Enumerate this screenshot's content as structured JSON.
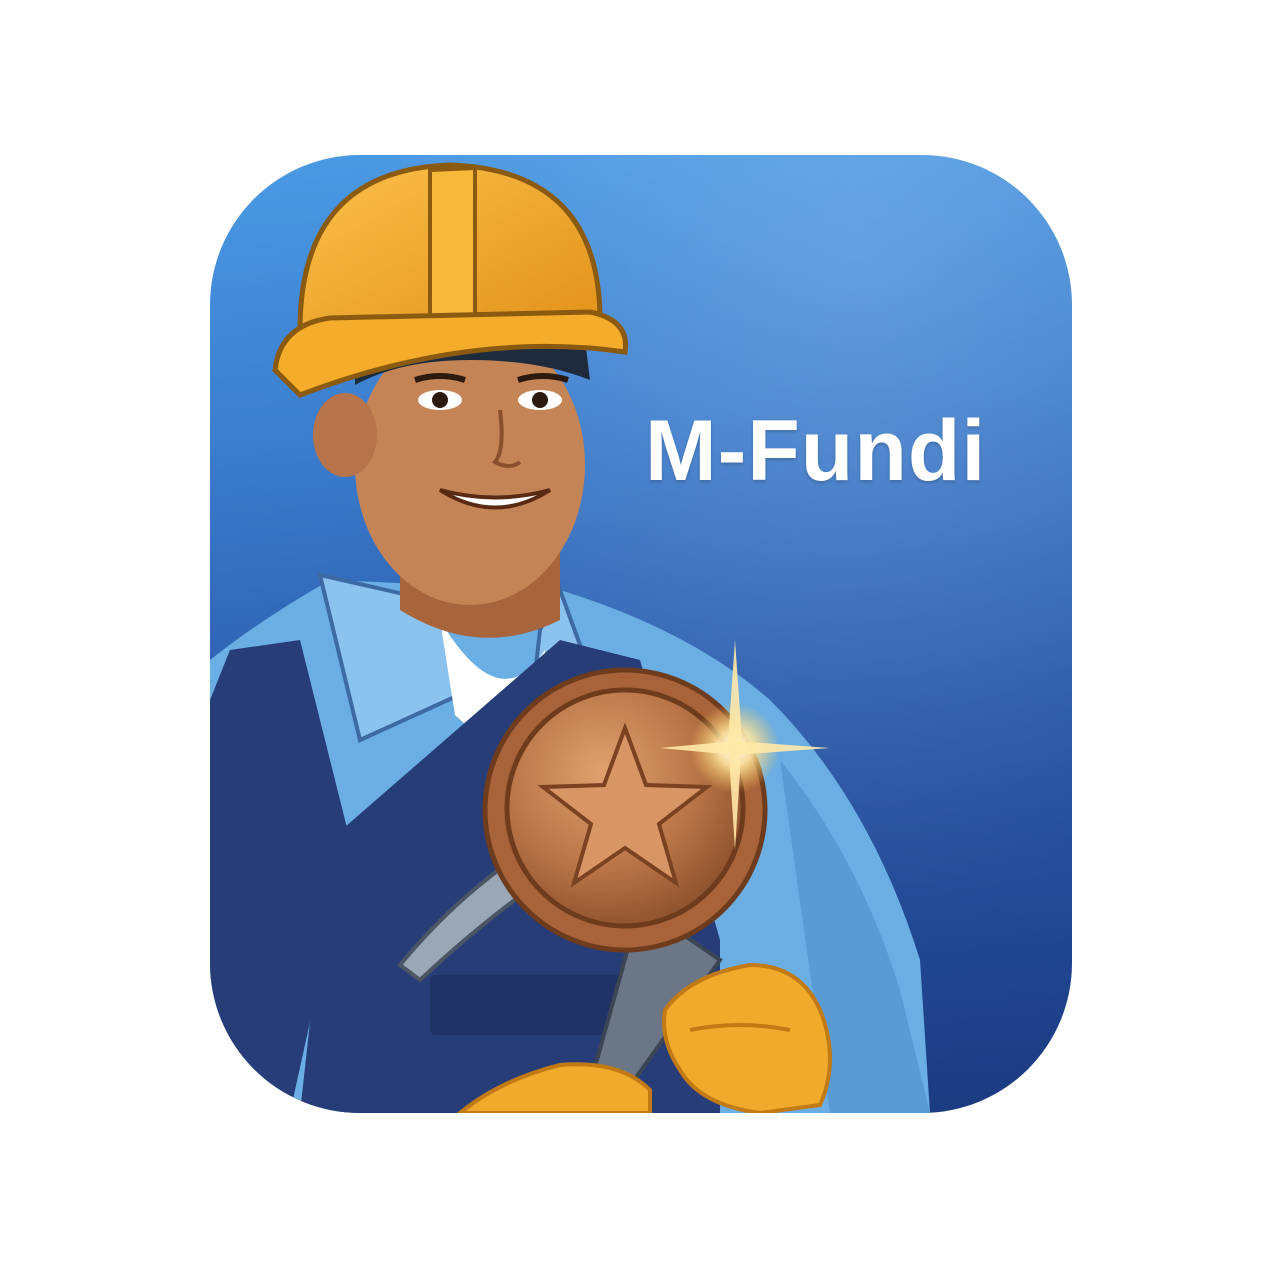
{
  "app_icon": {
    "brand_name": "M-Fundi"
  },
  "illustration": {
    "subject": "worker-with-medal",
    "icons": [
      "hard-hat-icon",
      "medal-icon",
      "star-icon",
      "pickaxe-icon",
      "sparkle-icon",
      "gloves-icon"
    ]
  },
  "colors": {
    "background_top": "#4a9ae4",
    "background_bottom": "#1b3a80",
    "hard_hat": "#f4ac2a",
    "shirt": "#6aaee3",
    "overalls": "#263d78",
    "medal": "#b77346",
    "gloves": "#f0aa2c",
    "title_text": "#ffffff"
  }
}
